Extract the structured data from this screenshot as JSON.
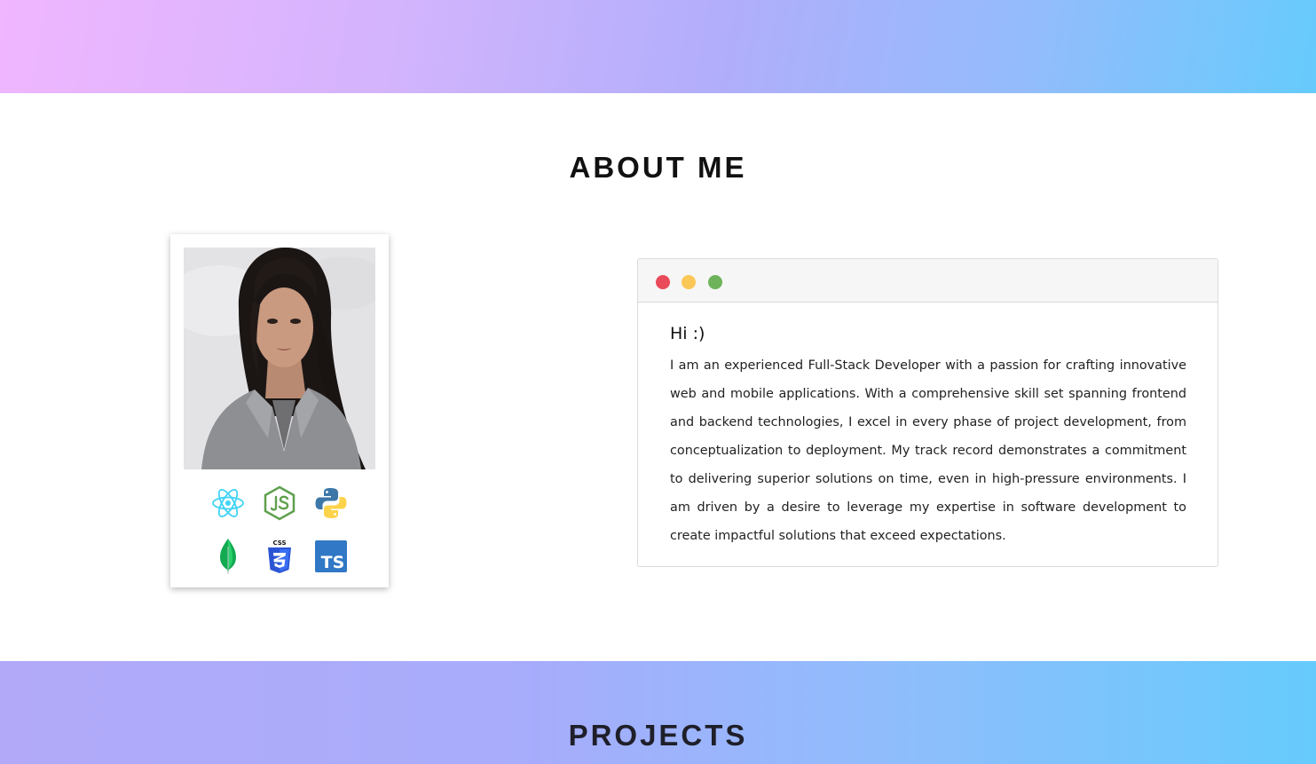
{
  "about": {
    "title": "ABOUT ME",
    "photo_alt": "Profile photo",
    "tech_icons": [
      "react-icon",
      "nodejs-icon",
      "python-icon",
      "mongodb-icon",
      "css3-icon",
      "typescript-icon"
    ],
    "tech_icon_text": {
      "css": "CSS",
      "ts": "TS"
    }
  },
  "window": {
    "controls": [
      "close",
      "minimize",
      "maximize"
    ],
    "colors": {
      "close": "#ea4a5a",
      "minimize": "#fbc756",
      "maximize": "#6eb35a"
    },
    "greeting": "Hi :)",
    "bio": "I am an experienced Full-Stack Developer with a passion for crafting innovative web and mobile applications. With a comprehensive skill set spanning frontend and backend technologies, I excel in every phase of project development, from conceptualization to deployment. My track record demonstrates a commitment to delivering superior solutions on time, even in high-pressure environments. I am driven by a desire to leverage my expertise in software development to create impactful solutions that exceed expectations."
  },
  "projects": {
    "title": "PROJECTS"
  },
  "theme": {
    "top_gradient": [
      "#f0b6ff",
      "#b1aefb",
      "#66cbfc"
    ],
    "bottom_gradient": [
      "#b2aaf9",
      "#66cbfc"
    ]
  }
}
